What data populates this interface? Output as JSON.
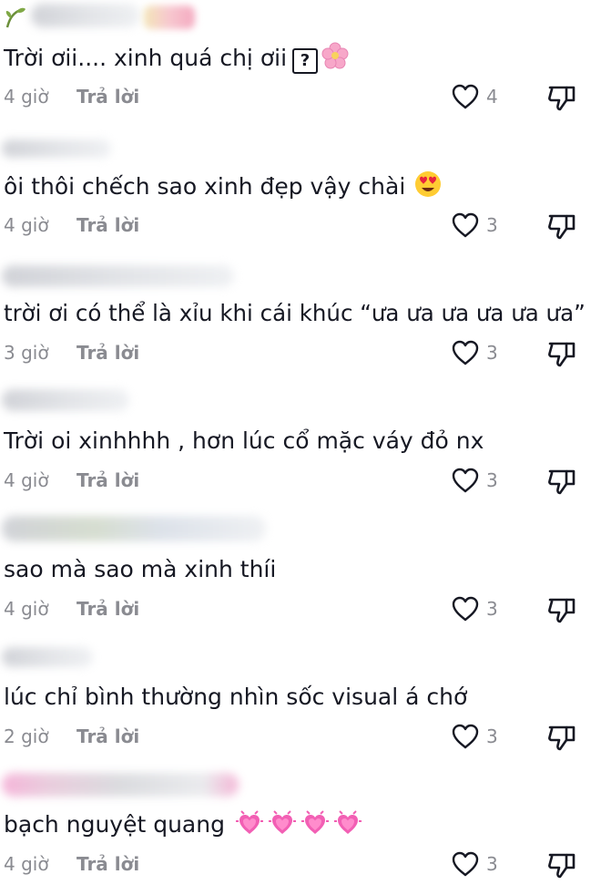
{
  "reply_label": "Trả lời",
  "comments": [
    {
      "text": "Trời ơii.... xinh quá chị ơii",
      "time": "4 giờ",
      "likes": "4",
      "trailing_glyph": "?",
      "emojis": [
        "cherry-blossom"
      ]
    },
    {
      "text": "ôi thôi chếch sao xinh đẹp vậy chài",
      "time": "4 giờ",
      "likes": "3",
      "emojis": [
        "heart-eyes"
      ]
    },
    {
      "text": "trời ơi có thể là xỉu khi cái khúc “ưa ưa ưa ưa ưa ưa”",
      "time": "3 giờ",
      "likes": "3",
      "emojis": []
    },
    {
      "text": "Trời oi xinhhhh , hơn lúc cổ mặc váy đỏ nx",
      "time": "4 giờ",
      "likes": "3",
      "emojis": []
    },
    {
      "text": "sao mà sao mà xinh thíi",
      "time": "4 giờ",
      "likes": "3",
      "emojis": []
    },
    {
      "text": "lúc chỉ bình thường nhìn sốc visual á chớ",
      "time": "2 giờ",
      "likes": "3",
      "emojis": []
    },
    {
      "text": "bạch nguyệt quang",
      "time": "4 giờ",
      "likes": "3",
      "emojis": [
        "growing-heart",
        "growing-heart",
        "growing-heart",
        "growing-heart"
      ]
    }
  ],
  "colors": {
    "text": "#161823",
    "muted": "#8a8b91",
    "icon": "#161823",
    "pink_heart": "#f25fb4"
  }
}
